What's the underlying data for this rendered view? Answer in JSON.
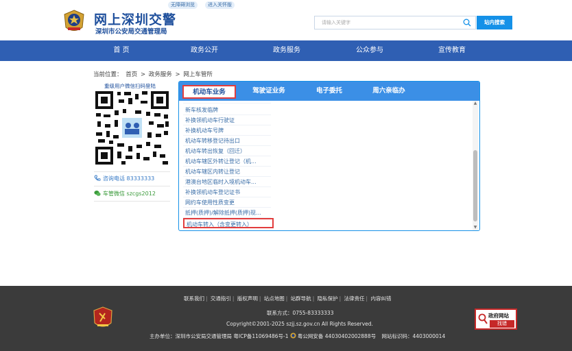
{
  "header": {
    "title": "网上深圳交警",
    "subtitle": "深圳市公安局交通管理局",
    "pill_accessible": "无障碍浏览",
    "pill_elderly": "进入关怀版",
    "search_placeholder": "请输入关键字",
    "search_button": "站内搜索"
  },
  "nav": {
    "items": [
      "首 页",
      "政务公开",
      "政务服务",
      "公众参与",
      "宣传教育"
    ]
  },
  "breadcrumb": {
    "prefix": "当前位置：",
    "items": [
      "首页",
      "政务服务",
      "网上车管所"
    ],
    "separator": ">"
  },
  "sidebar": {
    "qr_caption": "重级用户微信扫码登陆",
    "phone": "咨询电话 83333333",
    "wechat": "车管微信 szcgs2012"
  },
  "panel": {
    "tabs": [
      "机动车业务",
      "驾驶证业务",
      "电子委托",
      "周六亲临办"
    ],
    "active_tab": 0,
    "items": [
      "新车核发临牌",
      "补换领机动车行驶证",
      "补换机动车号牌",
      "机动车转移登记待出口",
      "机动车转出恢复（回迁）",
      "机动车辖区外转让登记（机...",
      "机动车辖区内转让登记",
      "港澳台地区临时入境机动车...",
      "补换领机动车登记证书",
      "网约车使用性质变更",
      "抵押(质押)/解除抵押(质押)现...",
      "机动车转入（含变更转入）"
    ],
    "highlighted_item": 11
  },
  "footer": {
    "links": [
      "联系我们",
      "交通指引",
      "版权声明",
      "站点地图",
      "站群导航",
      "隐私保护",
      "法律责任",
      "内容纠错"
    ],
    "contact": "联系方式：0755-83333333",
    "copyright": "Copyright©2001-2025 szjj.sz.gov.cn    All Rights Reserved.",
    "host": "主办单位：深圳市公安局交通管理局  粤ICP备11069486号-1",
    "police_record": "粤公网安备 44030402002888号",
    "site_code": "网站标识码：4403000014",
    "gov_badge_title": "政府网站",
    "gov_badge_action": "找错"
  },
  "colors": {
    "brand_blue": "#2f5fb3",
    "tab_blue": "#3b8fe6",
    "link_blue": "#3a6ea8",
    "highlight_red": "#e23c3c",
    "footer_bg": "#3b3b3b"
  }
}
